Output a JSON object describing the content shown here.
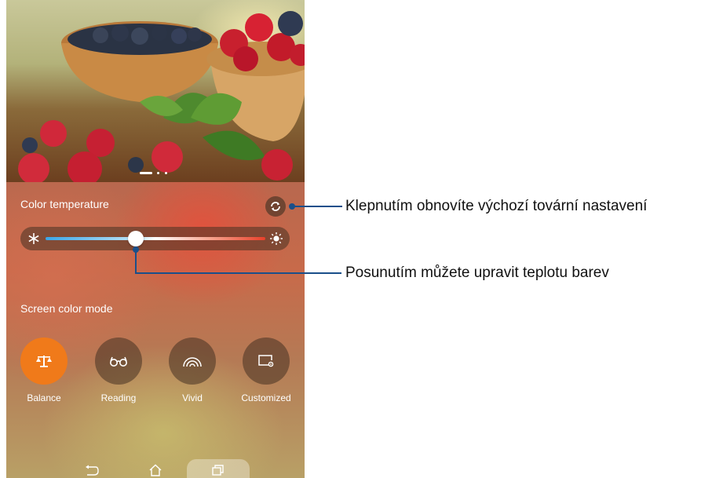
{
  "photo": {
    "page_indicator_count": 3,
    "page_indicator_active": 1
  },
  "color_temperature": {
    "label": "Color temperature",
    "level": 0.41
  },
  "screen_mode": {
    "label": "Screen color mode",
    "modes": [
      {
        "label": "Balance",
        "icon": "balance-scale-icon",
        "active": true
      },
      {
        "label": "Reading",
        "icon": "glasses-icon",
        "active": false
      },
      {
        "label": "Vivid",
        "icon": "vivid-arcs-icon",
        "active": false
      },
      {
        "label": "Customized",
        "icon": "customize-screen-icon",
        "active": false
      }
    ]
  },
  "callouts": {
    "reset": "Klepnutím obnovíte výchozí tovární nastavení",
    "slider": "Posunutím můžete upravit teplotu barev"
  },
  "colors": {
    "accent": "#f07a1a",
    "callout_line": "#1a4f8a",
    "slider_cold": "#3aa6e8",
    "slider_warm": "#e8402a"
  },
  "navbar": {
    "icons": [
      "back-icon",
      "home-icon",
      "recent-apps-icon"
    ]
  }
}
